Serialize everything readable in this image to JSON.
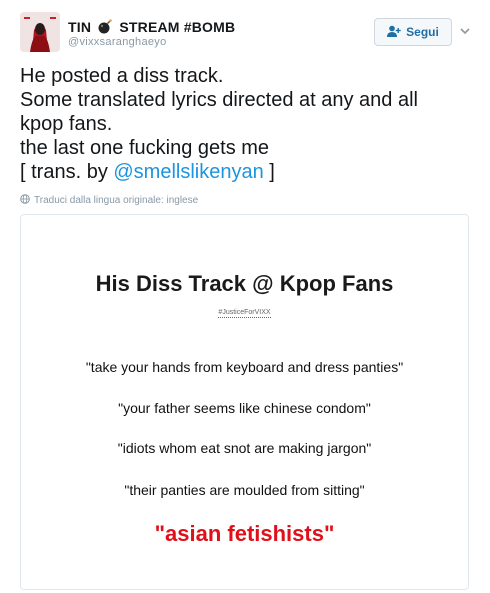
{
  "user": {
    "display_name_part1": "TIN",
    "display_name_part2": "STREAM #BOMB",
    "handle": "@vixxsaranghaeyo",
    "emoji_icon": "bomb-icon"
  },
  "follow_button": {
    "label": "Segui",
    "icon": "add-user-icon"
  },
  "tweet": {
    "line1": "He posted a diss track.",
    "line2": "Some translated lyrics directed at any and all",
    "line3": "kpop fans.",
    "line4": "the last one fucking gets me",
    "line5_prefix": "[ trans. by ",
    "mention": "@smellslikenyan",
    "line5_suffix": " ]"
  },
  "translate": {
    "label": "Traduci dalla lingua originale: inglese",
    "icon": "globe-icon"
  },
  "media": {
    "title": "His Diss Track @ Kpop Fans",
    "hashtag": "#JusticeForVIXX",
    "lyrics": [
      "\"take your hands from keyboard and dress panties\"",
      "\"your father seems like chinese condom\"",
      "\"idiots whom eat snot are making jargon\"",
      "\"their panties are moulded from sitting\""
    ],
    "highlight": "\"asian fetishists\"",
    "highlight_color": "#e0101a"
  },
  "colors": {
    "link": "#1b95e0",
    "muted": "#8899a6",
    "follow_text": "#1d6fa5"
  }
}
